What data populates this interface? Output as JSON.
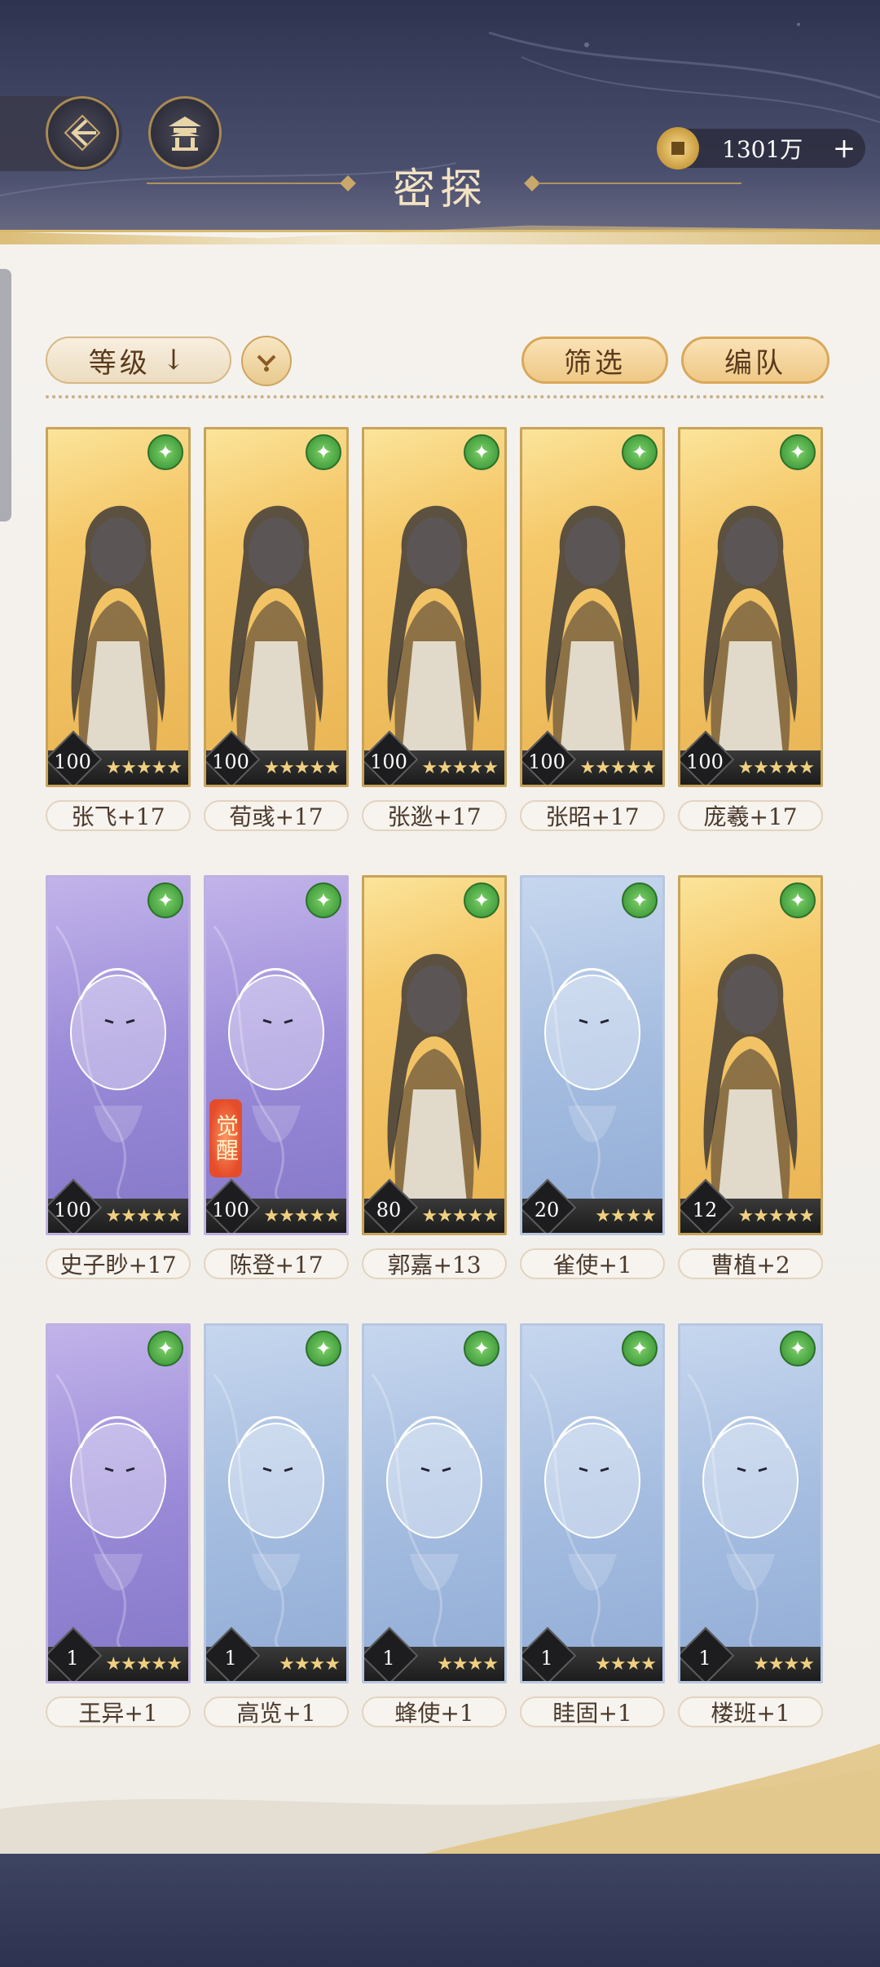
{
  "header": {
    "title": "密探",
    "currency": {
      "icon": "coin-icon",
      "value": "1301万",
      "add_symbol": "+"
    },
    "back_icon": "back-arrow-icon",
    "pavilion_icon": "pavilion-icon"
  },
  "toolbar": {
    "sort_label": "等级",
    "sort_arrow": "↓",
    "filter_label": "筛选",
    "team_label": "编队"
  },
  "cards": [
    {
      "name": "张飞+17",
      "level": "100",
      "style": "gold",
      "stars": "★★★★★"
    },
    {
      "name": "荀彧+17",
      "level": "100",
      "style": "gold",
      "stars": "★★★★★"
    },
    {
      "name": "张逖+17",
      "level": "100",
      "style": "gold",
      "stars": "★★★★★"
    },
    {
      "name": "张昭+17",
      "level": "100",
      "style": "gold",
      "stars": "★★★★★"
    },
    {
      "name": "庞羲+17",
      "level": "100",
      "style": "gold",
      "stars": "★★★★★"
    },
    {
      "name": "史子眇+17",
      "level": "100",
      "style": "purple",
      "stars": "★★★★★"
    },
    {
      "name": "陈登+17",
      "level": "100",
      "style": "purple",
      "stars": "★★★★★",
      "awaken": "觉醒"
    },
    {
      "name": "郭嘉+13",
      "level": "80",
      "style": "gold",
      "stars": "★★★★★"
    },
    {
      "name": "雀使+1",
      "level": "20",
      "style": "blue",
      "stars": "★★★★"
    },
    {
      "name": "曹植+2",
      "level": "12",
      "style": "gold",
      "stars": "★★★★★"
    },
    {
      "name": "王异+1",
      "level": "1",
      "style": "purple",
      "stars": "★★★★★"
    },
    {
      "name": "高览+1",
      "level": "1",
      "style": "blue",
      "stars": "★★★★"
    },
    {
      "name": "蜂使+1",
      "level": "1",
      "style": "blue",
      "stars": "★★★★"
    },
    {
      "name": "眭固+1",
      "level": "1",
      "style": "blue",
      "stars": "★★★★"
    },
    {
      "name": "楼班+1",
      "level": "1",
      "style": "blue",
      "stars": "★★★★"
    }
  ],
  "badge_symbol": "✦",
  "colors": {
    "gold": "#f5c86a",
    "purple": "#9a8ad8",
    "blue": "#a5bde0",
    "badge_green": "#3e9b3a"
  }
}
